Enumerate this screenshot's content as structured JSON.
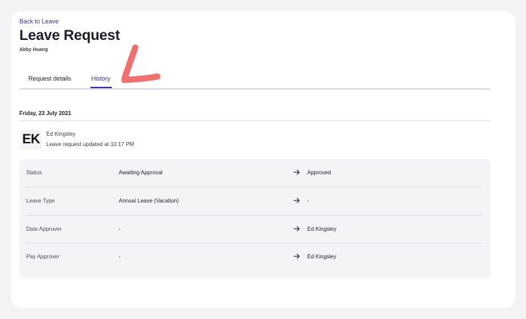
{
  "nav": {
    "back_label": "Back to Leave"
  },
  "header": {
    "title": "Leave Request",
    "employee": "Abby Huang"
  },
  "tabs": [
    {
      "label": "Request details",
      "active": false
    },
    {
      "label": "History",
      "active": true
    }
  ],
  "history": {
    "date": "Friday, 23 July 2021",
    "entry": {
      "avatar_initials": "EK",
      "actor": "Ed Kingsley",
      "description": "Leave request updated at 10:17 PM",
      "changes": [
        {
          "field": "Status",
          "from": "Awaiting Approval",
          "to": "Approved"
        },
        {
          "field": "Leave Type",
          "from": "Annual Leave (Vacation)",
          "to": "-"
        },
        {
          "field": "Date Approver",
          "from": "-",
          "to": "Ed Kingsley"
        },
        {
          "field": "Pay Approver",
          "from": "-",
          "to": "Ed Kingsley"
        }
      ]
    }
  },
  "icons": {
    "change_arrow": "arrow-right-icon",
    "annotation": "hand-drawn-l-mark"
  },
  "colors": {
    "accent": "#3a2bb8",
    "annotation": "#f2716c",
    "panel_background": "#f4f4f7"
  }
}
